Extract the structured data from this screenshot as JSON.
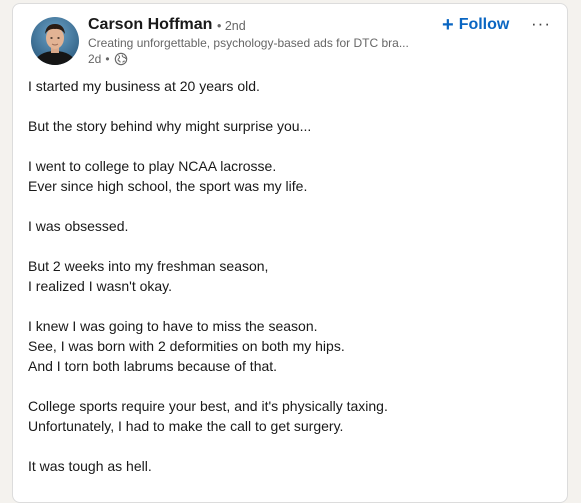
{
  "post": {
    "author": {
      "name": "Carson Hoffman",
      "degree": "• 2nd",
      "headline": "Creating unforgettable, psychology-based ads for DTC bra...",
      "time": "2d",
      "separator": "•",
      "visibility_icon": "globe-icon"
    },
    "actions": {
      "follow_label": "Follow",
      "follow_icon": "plus-icon",
      "more_label": "···"
    },
    "lines": [
      "I started my business at 20 years old.",
      "",
      "But the story behind why might surprise you...",
      "",
      "I went to college to play NCAA lacrosse.",
      "Ever since high school, the sport was my life.",
      "",
      "I was obsessed.",
      "",
      "But 2 weeks into my freshman season,",
      "I realized I wasn't okay.",
      "",
      "I knew I was going to have to miss the season.",
      "See, I was born with 2 deformities on both my hips.",
      "And I torn both labrums because of that.",
      "",
      "College sports require your best, and it's physically taxing.",
      "Unfortunately, I had to make the call to get surgery.",
      "",
      "It was tough as hell."
    ]
  },
  "colors": {
    "accent": "#0a66c2",
    "text": "#191919",
    "muted": "#666666",
    "background": "#f4f2ee",
    "card": "#ffffff"
  }
}
